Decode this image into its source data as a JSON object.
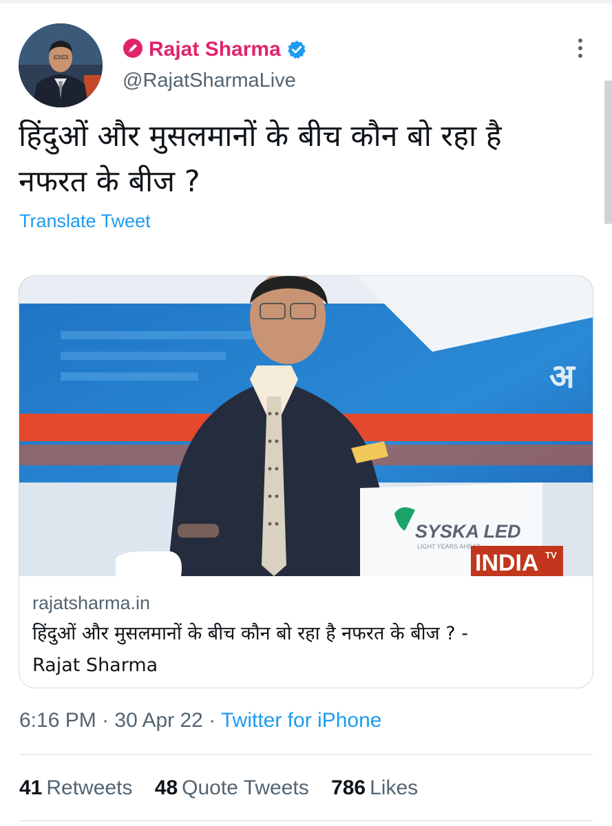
{
  "author": {
    "display_name": "Rajat Sharma",
    "handle": "@RajatSharmaLive",
    "avatar_icon": "profile-photo",
    "name_color": "#e0246c",
    "verified": true
  },
  "tweet": {
    "text_line1": "हिंदुओं और मुसलमानों के बीच कौन बो रहा है",
    "text_line2": "नफरत के बीज ?",
    "translate_label": "Translate Tweet"
  },
  "card": {
    "media_logo_syska": "SYSKA LED",
    "media_logo_syska_tagline": "LIGHT YEARS AHEAD",
    "media_logo_channel": "INDIA",
    "media_logo_channel_tv": "TV",
    "domain": "rajatsharma.in",
    "title_line1": "हिंदुओं और मुसलमानों के बीच कौन बो रहा है नफरत के बीज ? -",
    "title_line2": "Rajat Sharma"
  },
  "meta": {
    "time": "6:16 PM",
    "separator": "·",
    "date": "30 Apr 22",
    "source": "Twitter for iPhone"
  },
  "stats": {
    "retweets_count": "41",
    "retweets_label": "Retweets",
    "quotes_count": "48",
    "quotes_label": "Quote Tweets",
    "likes_count": "786",
    "likes_label": "Likes"
  },
  "colors": {
    "link_blue": "#1d9bf0",
    "secondary_text": "#536471",
    "divider": "#cfd9de"
  }
}
